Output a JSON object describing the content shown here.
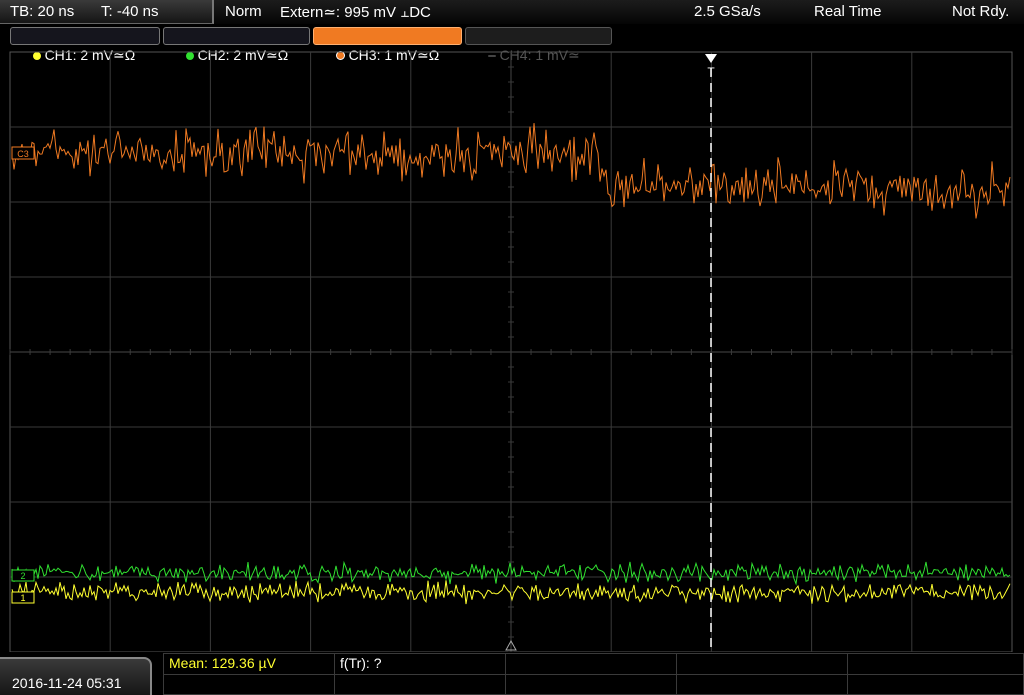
{
  "topbar": {
    "timebase": "TB: 20 ns",
    "trigger_time": "T: -40 ns",
    "acq_mode": "Norm",
    "trigger_source": "Extern≃: 995 mV ⫠DC",
    "sample_rate": "2.5 GSa/s",
    "acq_type": "Real Time",
    "trigger_status": "Not Rdy."
  },
  "channels": [
    {
      "label": "CH1: 2 mV≃Ω",
      "color": "#ffff30",
      "active": true
    },
    {
      "label": "CH2: 2 mV≃Ω",
      "color": "#30e030",
      "active": true
    },
    {
      "label": "CH3: 1 mV≃Ω",
      "color": "#f07a22",
      "active": true,
      "selected": true
    },
    {
      "label": "CH4: 1 mV≃",
      "color": "#555555",
      "active": false
    }
  ],
  "waveforms": {
    "ch1_color": "#ffff30",
    "ch2_color": "#30e030",
    "ch3_color": "#f07a22",
    "ch1_marker": "1",
    "ch2_marker": "2",
    "ch3_marker": "C3",
    "trigger_marker": "T"
  },
  "bottombar": {
    "datetime": "2016-11-24 05:31",
    "measurement_1": "Mean: 129.36 µV",
    "measurement_2": "f(Tr): ?"
  },
  "colors": {
    "grid": "#3a3a3a",
    "measurement_yellow": "#ffff30",
    "trigger_line": "#ffffff"
  }
}
